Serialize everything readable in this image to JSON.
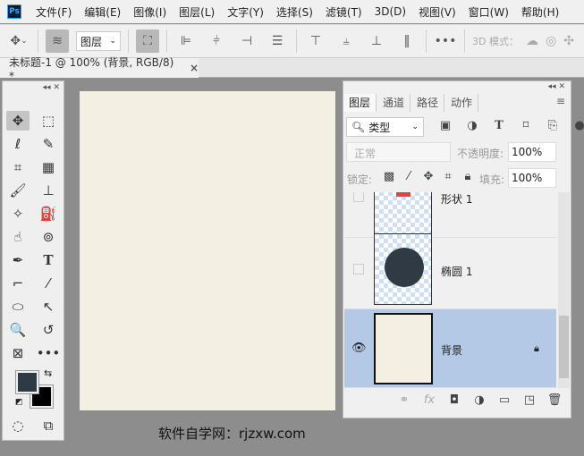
{
  "menubar": {
    "logo": "Ps",
    "items": [
      "文件(F)",
      "编辑(E)",
      "图像(I)",
      "图层(L)",
      "文字(Y)",
      "选择(S)",
      "滤镜(T)",
      "3D(D)",
      "视图(V)",
      "窗口(W)",
      "帮助(H)"
    ]
  },
  "options": {
    "auto_select_value": "图层",
    "mode_label": "3D 模式："
  },
  "document_tab": {
    "title": "未标题-1 @ 100% (背景, RGB/8) *",
    "close": "×"
  },
  "canvas": {
    "color": "#f3efe2"
  },
  "toolbox": {
    "foreground_color": "#2f3a44",
    "background_color": "#000000"
  },
  "layers_panel": {
    "tabs": [
      "图层",
      "通道",
      "路径",
      "动作"
    ],
    "filter_value": "类型",
    "blend_mode": "正常",
    "opacity_label": "不透明度:",
    "opacity_value": "100%",
    "lock_label": "锁定:",
    "fill_label": "填充:",
    "fill_value": "100%",
    "layers": [
      {
        "name": "形状 1",
        "visible": false
      },
      {
        "name": "椭圆 1",
        "visible": false
      },
      {
        "name": "背景",
        "visible": true,
        "selected": true,
        "locked": true
      }
    ],
    "selected_color": "#b3c9e6"
  },
  "watermark": "软件自学网：rjzxw.com"
}
